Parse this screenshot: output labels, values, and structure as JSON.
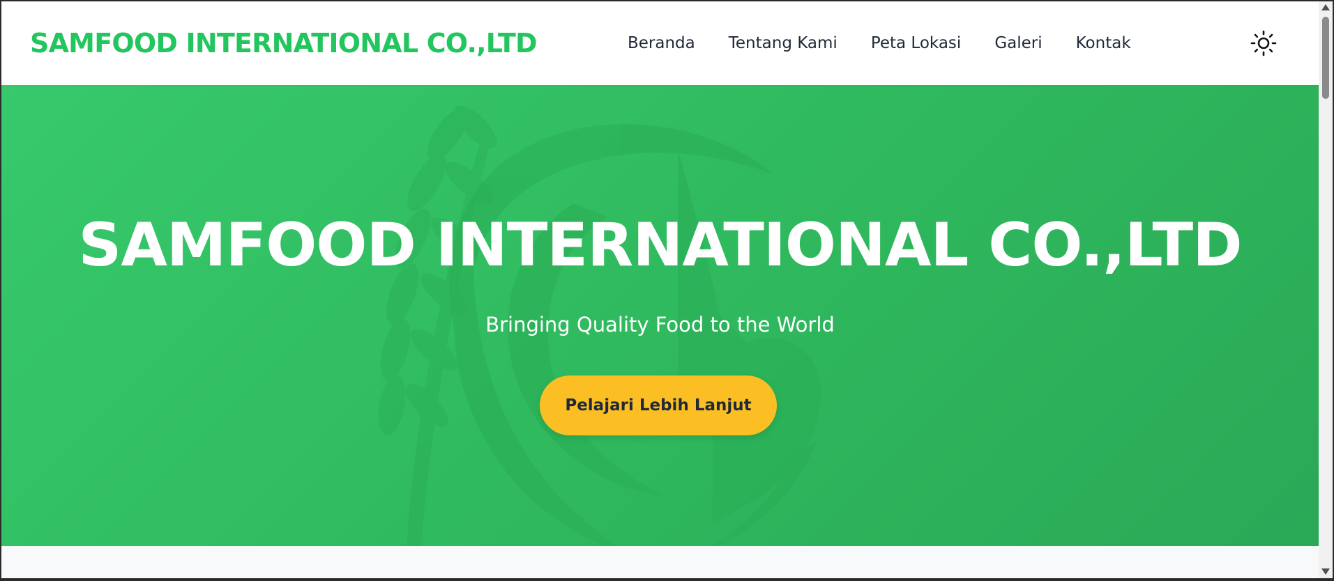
{
  "header": {
    "brand": "SAMFOOD INTERNATIONAL CO.,LTD",
    "nav": [
      {
        "label": "Beranda"
      },
      {
        "label": "Tentang Kami"
      },
      {
        "label": "Peta Lokasi"
      },
      {
        "label": "Galeri"
      },
      {
        "label": "Kontak"
      }
    ],
    "theme_toggle_icon": "sun-icon"
  },
  "hero": {
    "title": "SAMFOOD INTERNATIONAL CO.,LTD",
    "subtitle": "Bringing Quality Food to the World",
    "cta_label": "Pelajari Lebih Lanjut",
    "background_icon": "rice-leaf-circle-logo-icon"
  },
  "colors": {
    "brand_green": "#22c55e",
    "hero_green": "#2fb85d",
    "cta_yellow": "#fbbf24",
    "nav_text": "#1f2937"
  }
}
